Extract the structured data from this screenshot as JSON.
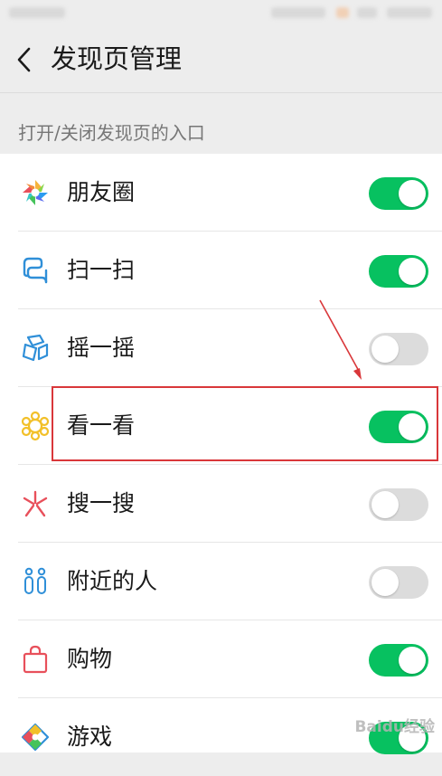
{
  "navbar": {
    "back_icon": "chevron-left-icon",
    "title": "发现页管理"
  },
  "section": {
    "header": "打开/关闭发现页的入口"
  },
  "items": [
    {
      "label": "朋友圈",
      "icon": "moments-aperture-icon",
      "enabled": true
    },
    {
      "label": "扫一扫",
      "icon": "scan-icon",
      "enabled": true
    },
    {
      "label": "摇一摇",
      "icon": "shake-icon",
      "enabled": false
    },
    {
      "label": "看一看",
      "icon": "top-stories-icon",
      "enabled": true
    },
    {
      "label": "搜一搜",
      "icon": "search-burst-icon",
      "enabled": false
    },
    {
      "label": "附近的人",
      "icon": "people-nearby-icon",
      "enabled": false
    },
    {
      "label": "购物",
      "icon": "shopping-bag-icon",
      "enabled": true
    },
    {
      "label": "游戏",
      "icon": "game-icon",
      "enabled": true
    }
  ],
  "colors": {
    "toggle_on": "#07c160",
    "toggle_off": "#dcdcdc",
    "annotation": "#d9373a"
  },
  "watermark": "Baidu经验"
}
